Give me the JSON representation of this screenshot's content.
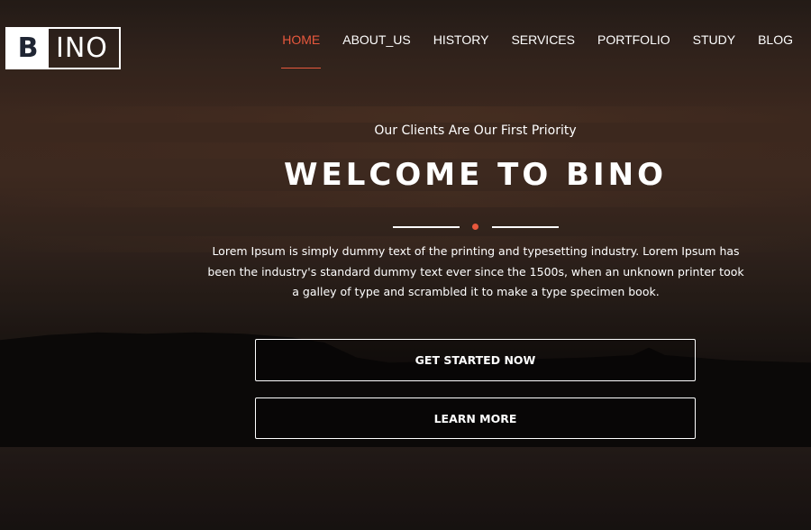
{
  "logo": {
    "letter": "B",
    "rest": "INO"
  },
  "nav": {
    "items": [
      {
        "label": "HOME",
        "active": true
      },
      {
        "label": "ABOUT_US"
      },
      {
        "label": "HISTORY"
      },
      {
        "label": "SERVICES"
      },
      {
        "label": "PORTFOLIO"
      },
      {
        "label": "STUDY"
      },
      {
        "label": "BLOG"
      }
    ]
  },
  "hero": {
    "subtitle": "Our Clients Are Our First Priority",
    "title": "WELCOME TO BINO",
    "description": "Lorem Ipsum is simply dummy text of the printing and typesetting industry. Lorem Ipsum has been the industry's standard dummy text ever since the 1500s, when an unknown printer took a galley of type and scrambled it to make a type specimen book.",
    "primary_button": "GET STARTED NOW",
    "secondary_button": "LEARN MORE"
  },
  "colors": {
    "accent": "#e8583d",
    "text": "#ffffff",
    "logo_dark": "#1f2533"
  }
}
